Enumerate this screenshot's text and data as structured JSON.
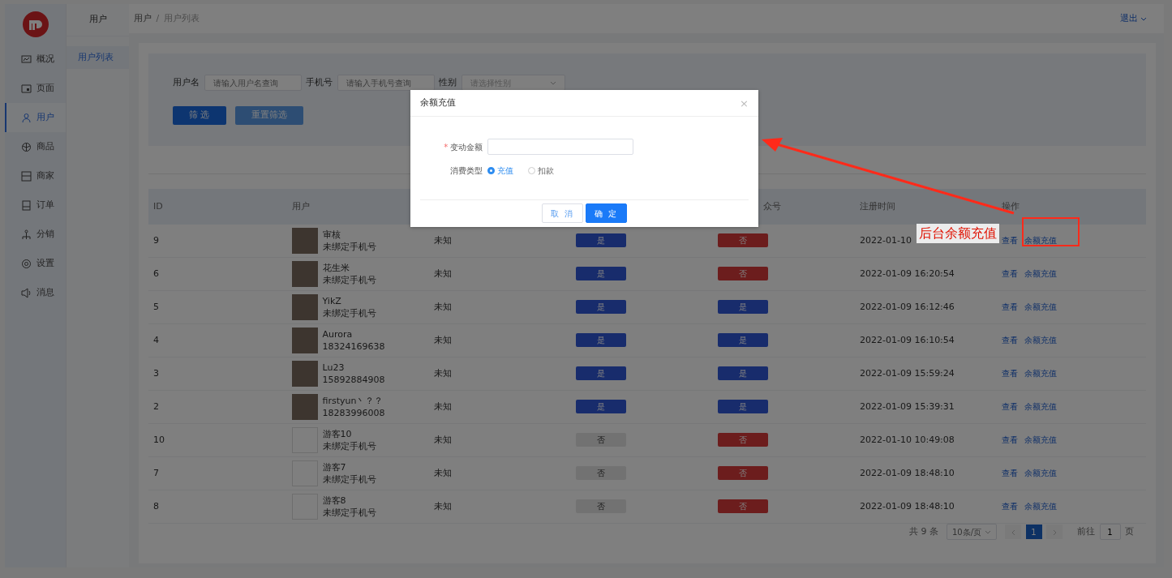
{
  "sidebar": {
    "items": [
      {
        "label": "概况",
        "selected": false
      },
      {
        "label": "页面",
        "selected": false
      },
      {
        "label": "用户",
        "selected": true
      },
      {
        "label": "商品",
        "selected": false
      },
      {
        "label": "商家",
        "selected": false
      },
      {
        "label": "订单",
        "selected": false
      },
      {
        "label": "分销",
        "selected": false
      },
      {
        "label": "设置",
        "selected": false
      },
      {
        "label": "消息",
        "selected": false
      }
    ]
  },
  "subnav": {
    "title": "用户",
    "items": [
      {
        "label": "用户列表",
        "selected": true
      }
    ]
  },
  "breadcrumb": {
    "items": [
      "用户",
      "用户列表"
    ],
    "separator": "/"
  },
  "logout": "退出",
  "filters": {
    "fields": [
      {
        "label": "用户名",
        "placeholder": "请输入用户名查询",
        "kind": "input"
      },
      {
        "label": "手机号",
        "placeholder": "请输入手机号查询",
        "kind": "input"
      },
      {
        "label": "性别",
        "placeholder": "请选择性别",
        "kind": "select"
      }
    ],
    "buttons": [
      {
        "label": "筛 选",
        "kind": "primary"
      },
      {
        "label": "重置筛选",
        "kind": "secondary"
      }
    ]
  },
  "table": {
    "columns": [
      "ID",
      "用户",
      "",
      "",
      "众号",
      "注册时间",
      "操作"
    ],
    "rows": [
      {
        "id": "9",
        "name": "审核",
        "phone": "未绑定手机号",
        "avatar": {
          "kind": "photo"
        },
        "gender": "未知",
        "flag_1": {
          "text": "是",
          "kind": "positive"
        },
        "flag_2": {
          "text": "否",
          "kind": "negative"
        },
        "time": "2022-01-10",
        "actions": [
          "查看",
          "余额充值"
        ]
      },
      {
        "id": "6",
        "name": "花生米",
        "phone": "未绑定手机号",
        "avatar": {
          "kind": "photo"
        },
        "gender": "未知",
        "flag_1": {
          "text": "是",
          "kind": "positive"
        },
        "flag_2": {
          "text": "否",
          "kind": "negative"
        },
        "time": "2022-01-09 16:20:54",
        "actions": [
          "查看",
          "余额充值"
        ]
      },
      {
        "id": "5",
        "name": "YikZ",
        "phone": "未绑定手机号",
        "avatar": {
          "kind": "photo"
        },
        "gender": "未知",
        "flag_1": {
          "text": "是",
          "kind": "positive"
        },
        "flag_2": {
          "text": "是",
          "kind": "positive"
        },
        "time": "2022-01-09 16:12:46",
        "actions": [
          "查看",
          "余额充值"
        ]
      },
      {
        "id": "4",
        "name": "Aurora",
        "phone": "18324169638",
        "avatar": {
          "kind": "photo"
        },
        "gender": "未知",
        "flag_1": {
          "text": "是",
          "kind": "positive"
        },
        "flag_2": {
          "text": "是",
          "kind": "positive"
        },
        "time": "2022-01-09 16:10:54",
        "actions": [
          "查看",
          "余额充值"
        ]
      },
      {
        "id": "3",
        "name": "Lu23",
        "phone": "15892884908",
        "avatar": {
          "kind": "photo"
        },
        "gender": "未知",
        "flag_1": {
          "text": "是",
          "kind": "positive"
        },
        "flag_2": {
          "text": "是",
          "kind": "positive"
        },
        "time": "2022-01-09 15:59:24",
        "actions": [
          "查看",
          "余额充值"
        ]
      },
      {
        "id": "2",
        "name": "firstyun丶？？",
        "phone": "18283996008",
        "avatar": {
          "kind": "photo"
        },
        "gender": "未知",
        "flag_1": {
          "text": "是",
          "kind": "positive"
        },
        "flag_2": {
          "text": "是",
          "kind": "positive"
        },
        "time": "2022-01-09 15:39:31",
        "actions": [
          "查看",
          "余额充值"
        ]
      },
      {
        "id": "10",
        "name": "游客10",
        "phone": "未绑定手机号",
        "avatar": {
          "kind": "empty"
        },
        "gender": "未知",
        "flag_1": {
          "text": "否",
          "kind": "neutral"
        },
        "flag_2": {
          "text": "否",
          "kind": "negative"
        },
        "time": "2022-01-10 10:49:08",
        "actions": [
          "查看",
          "余额充值"
        ]
      },
      {
        "id": "7",
        "name": "游客7",
        "phone": "未绑定手机号",
        "avatar": {
          "kind": "empty"
        },
        "gender": "未知",
        "flag_1": {
          "text": "否",
          "kind": "neutral"
        },
        "flag_2": {
          "text": "否",
          "kind": "negative"
        },
        "time": "2022-01-09 18:48:10",
        "actions": [
          "查看",
          "余额充值"
        ]
      },
      {
        "id": "8",
        "name": "游客8",
        "phone": "未绑定手机号",
        "avatar": {
          "kind": "empty"
        },
        "gender": "未知",
        "flag_1": {
          "text": "否",
          "kind": "neutral"
        },
        "flag_2": {
          "text": "否",
          "kind": "negative"
        },
        "time": "2022-01-09 18:48:10",
        "actions": [
          "查看",
          "余额充值"
        ]
      }
    ]
  },
  "pagination": {
    "total": "共 9 条",
    "page_size": "10条/页",
    "pages": [
      {
        "label": "1",
        "selected": true
      }
    ],
    "goto_label": "前往",
    "goto_value": "1",
    "goto_suffix": "页"
  },
  "modal": {
    "title": "余额充值",
    "close": "×",
    "amount": {
      "label": "变动金额",
      "required_mark": "*"
    },
    "type": {
      "label": "消费类型",
      "options": [
        {
          "label": "充值",
          "selected": true
        },
        {
          "label": "扣款",
          "selected": false
        }
      ]
    },
    "buttons": [
      {
        "label": "取 消",
        "kind": "secondary"
      },
      {
        "label": "确 定",
        "kind": "primary"
      }
    ]
  },
  "annotation": {
    "text": "后台余额充值"
  }
}
